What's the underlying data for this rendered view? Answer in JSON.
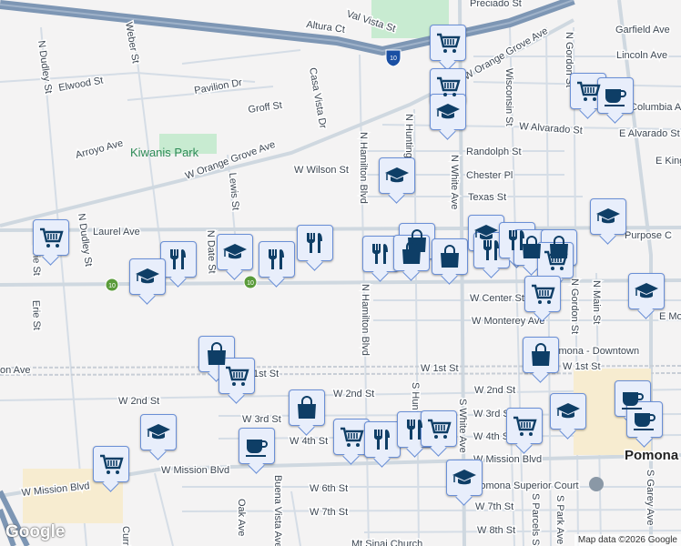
{
  "streets": {
    "altura": "Altura Ct",
    "val_vista": "Val Vista St",
    "preciado": "Preciado St",
    "weber": "Weber St",
    "n_dudley": "N Dudley St",
    "n_dudley2": "N Dudley St",
    "elwood": "Elwood St",
    "pavilion": "Pavilion Dr",
    "groff": "Groff St",
    "casa_vista": "Casa Vista Dr",
    "arroyo": "Arroyo Ave",
    "orange_grove_w": "W Orange Grove Ave",
    "orange_grove_e": "W Orange Grove Ave",
    "lewis": "Lewis St",
    "wilson": "W Wilson St",
    "laurel": "Laurel Ave",
    "n_date": "N Date St",
    "erie": "Erie St",
    "n_hamilton": "N Hamilton Blvd",
    "n_hamilton2": "N Hamilton Blvd",
    "n_huntington": "N Huntington",
    "n_white": "N White Ave",
    "wisconsin": "Wisconsin St",
    "n_gordon": "N Gordon St",
    "n_gordon2": "N Gordon St",
    "garfield": "Garfield Ave",
    "lincoln": "Lincoln Ave",
    "columbia": "Columbia Ave",
    "w_alvarado": "W Alvarado St",
    "e_alvarado": "E Alvarado St",
    "randolph": "Randolph St",
    "chester": "Chester Pl",
    "texas": "Texas St",
    "e_king": "E King",
    "purpose": "Purpose C",
    "center": "W Center St",
    "monterey": "W Monterey Ave",
    "e_monterey": "E Mo",
    "n_main": "N Main St",
    "downtown": "Pomona - Downtown",
    "w_1st_a": "1st St",
    "w_1st_b": "W 1st St",
    "w_1st_c": "W 1st St",
    "holt": "on Ave",
    "w_2nd_a": "W 2nd St",
    "w_2nd_b": "W 2nd St",
    "w_2nd_c": "W 2nd St",
    "w_3rd_a": "W 3rd St",
    "w_3rd_b": "W 3rd St",
    "w_4th_a": "W 4th St",
    "w_4th_b": "W 4th St",
    "mission_a": "W Mission Blvd",
    "mission_b": "W Mission Blvd",
    "mission_c": "W Mission Blvd",
    "w_6th": "W 6th St",
    "w_7th_a": "W 7th St",
    "w_7th_b": "W 7th St",
    "w_8th": "W 8th St",
    "oak": "Oak Ave",
    "buena_vista": "Buena Vista Ave",
    "s_white": "S White Ave",
    "s_huntington": "S Hun",
    "s_parcels": "S Parcels St",
    "s_park": "S Park Ave",
    "s_garey": "S Garey Ave",
    "superior_court": "Pomona Superior Court",
    "mt_sinai": "Mt Sinai Church",
    "pomona": "Pomona",
    "currier": "Currier",
    "kiwanis": "Kiwanis Park",
    "i10": "10"
  },
  "markers": [
    "grocery",
    "grocery",
    "school",
    "school",
    "grocery",
    "cafe",
    "grocery",
    "restaurant",
    "school",
    "restaurant",
    "school",
    "restaurant",
    "restaurant",
    "shopping",
    "shopping",
    "shopping",
    "school",
    "restaurant",
    "restaurant",
    "shopping",
    "shopping",
    "grocery",
    "school",
    "school",
    "grocery",
    "shopping",
    "shopping",
    "grocery",
    "shopping",
    "school",
    "cafe",
    "grocery",
    "school",
    "cafe",
    "cafe",
    "grocery",
    "school",
    "grocery",
    "restaurant",
    "restaurant",
    "grocery"
  ],
  "attribution": {
    "logo": "Google",
    "text": "Map data ©2026 Google"
  }
}
